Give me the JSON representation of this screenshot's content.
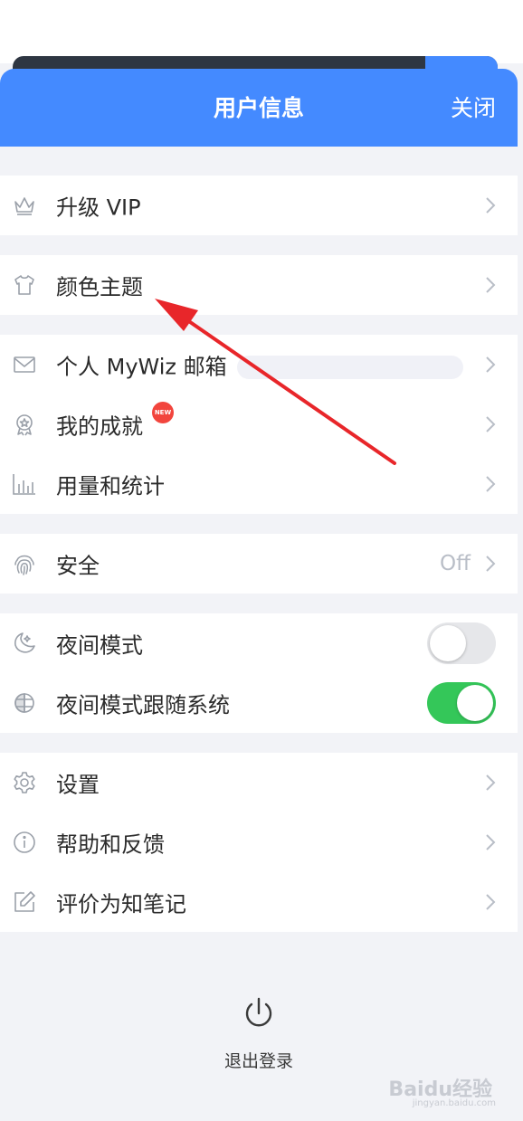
{
  "header": {
    "title": "用户信息",
    "close_label": "关闭"
  },
  "groups": [
    {
      "items": [
        {
          "icon": "crown-icon",
          "label": "升级 VIP"
        }
      ]
    },
    {
      "items": [
        {
          "icon": "tshirt-icon",
          "label": "颜色主题"
        }
      ]
    },
    {
      "items": [
        {
          "icon": "mail-icon",
          "label": "个人 MyWiz 邮箱"
        },
        {
          "icon": "medal-icon",
          "label": "我的成就",
          "badge": "NEW"
        },
        {
          "icon": "bar-chart-icon",
          "label": "用量和统计"
        }
      ]
    },
    {
      "items": [
        {
          "icon": "fingerprint-icon",
          "label": "安全",
          "value": "Off"
        }
      ]
    },
    {
      "items": [
        {
          "icon": "moon-icon",
          "label": "夜间模式",
          "toggle": false
        },
        {
          "icon": "globe-icon",
          "label": "夜间模式跟随系统",
          "toggle": true
        }
      ]
    },
    {
      "items": [
        {
          "icon": "gear-icon",
          "label": "设置"
        },
        {
          "icon": "info-icon",
          "label": "帮助和反馈"
        },
        {
          "icon": "edit-icon",
          "label": "评价为知笔记"
        }
      ]
    }
  ],
  "logout": {
    "icon": "power-icon",
    "label": "退出登录"
  },
  "watermark": {
    "brand": "Baidu经验",
    "url": "jingyan.baidu.com"
  },
  "colors": {
    "header": "#448aff",
    "toggle_on": "#34c759",
    "toggle_off": "#e6e7ea",
    "annotation_arrow": "#e8262a",
    "badge": "#f2453d"
  }
}
